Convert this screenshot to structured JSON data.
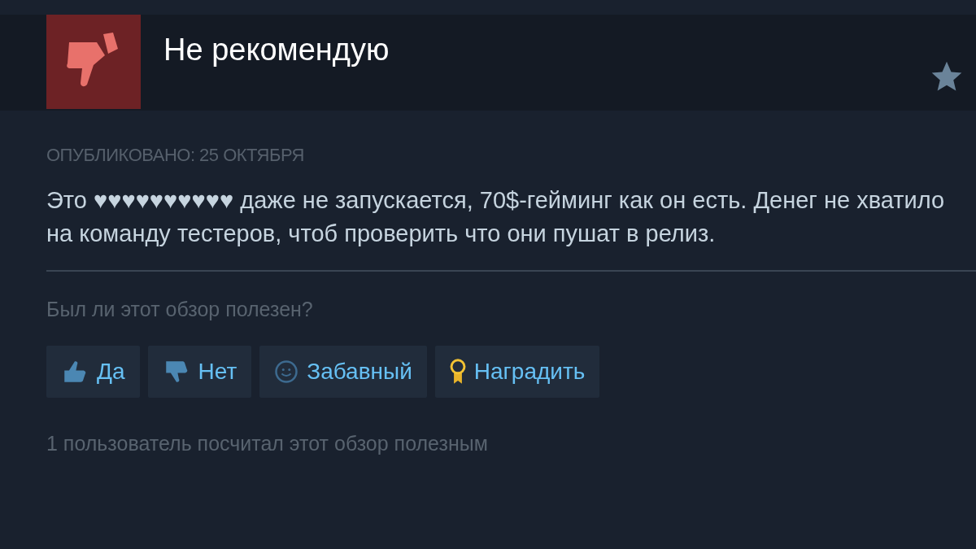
{
  "review": {
    "recommended": false,
    "verdict": "Не рекомендую",
    "posted": "ОПУБЛИКОВАНО: 25 ОКТЯБРЯ",
    "text": "Это ♥♥♥♥♥♥♥♥♥♥ даже не запускается, 70$-гейминг как он есть. Денег не хватило на команду тестеров, чтоб проверить что они пушат в релиз."
  },
  "feedback": {
    "question": "Был ли этот обзор полезен?",
    "buttons": [
      {
        "kind": "yes",
        "label": "Да"
      },
      {
        "kind": "no",
        "label": "Нет"
      },
      {
        "kind": "funny",
        "label": "Забавный"
      },
      {
        "kind": "award",
        "label": "Наградить"
      }
    ],
    "summary": "1 пользователь посчитал этот обзор полезным"
  }
}
